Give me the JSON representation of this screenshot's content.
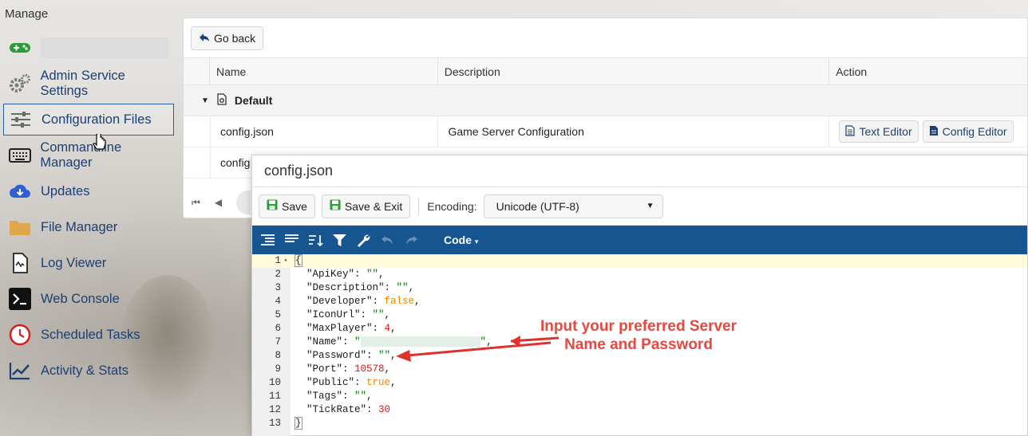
{
  "sidebar": {
    "title": "Manage",
    "items": [
      {
        "label": "",
        "icon": "gamepad-icon",
        "redacted": true
      },
      {
        "label": "Admin Service Settings",
        "icon": "gears-icon"
      },
      {
        "label": "Configuration Files",
        "icon": "sliders-icon",
        "active": true
      },
      {
        "label": "Commandline Manager",
        "icon": "keyboard-icon"
      },
      {
        "label": "Updates",
        "icon": "cloud-download-icon"
      },
      {
        "label": "File Manager",
        "icon": "folder-icon"
      },
      {
        "label": "Log Viewer",
        "icon": "log-file-icon"
      },
      {
        "label": "Web Console",
        "icon": "terminal-icon"
      },
      {
        "label": "Scheduled Tasks",
        "icon": "clock-icon"
      },
      {
        "label": "Activity & Stats",
        "icon": "chart-line-icon"
      }
    ]
  },
  "main": {
    "go_back_label": "Go back",
    "columns": {
      "name": "Name",
      "description": "Description",
      "action": "Action"
    },
    "group": {
      "label": "Default"
    },
    "rows": [
      {
        "name": "config.json",
        "description": "Game Server Configuration",
        "actions": [
          "Text Editor",
          "Config Editor"
        ]
      },
      {
        "name": "config",
        "description": "",
        "actions": []
      }
    ]
  },
  "editor": {
    "title": "config.json",
    "save_label": "Save",
    "save_exit_label": "Save & Exit",
    "encoding_label": "Encoding:",
    "encoding_value": "Unicode (UTF-8)",
    "code_menu_label": "Code",
    "lines": [
      {
        "n": "1",
        "parts": [
          [
            "p",
            "{"
          ]
        ]
      },
      {
        "n": "2",
        "parts": [
          [
            "k",
            "\"ApiKey\""
          ],
          [
            "p",
            ": "
          ],
          [
            "s",
            "\"\""
          ],
          [
            "p",
            ","
          ]
        ]
      },
      {
        "n": "3",
        "parts": [
          [
            "k",
            "\"Description\""
          ],
          [
            "p",
            ": "
          ],
          [
            "s",
            "\"\""
          ],
          [
            "p",
            ","
          ]
        ]
      },
      {
        "n": "4",
        "parts": [
          [
            "k",
            "\"Developer\""
          ],
          [
            "p",
            ": "
          ],
          [
            "b",
            "false"
          ],
          [
            "p",
            ","
          ]
        ]
      },
      {
        "n": "5",
        "parts": [
          [
            "k",
            "\"IconUrl\""
          ],
          [
            "p",
            ": "
          ],
          [
            "s",
            "\"\""
          ],
          [
            "p",
            ","
          ]
        ]
      },
      {
        "n": "6",
        "parts": [
          [
            "k",
            "\"MaxPlayer\""
          ],
          [
            "p",
            ": "
          ],
          [
            "n",
            "4"
          ],
          [
            "p",
            ","
          ]
        ]
      },
      {
        "n": "7",
        "parts": [
          [
            "k",
            "\"Name\""
          ],
          [
            "p",
            ": "
          ],
          [
            "s",
            "\""
          ],
          [
            "r",
            ""
          ],
          [
            "s",
            "\""
          ],
          [
            "p",
            ","
          ]
        ]
      },
      {
        "n": "8",
        "parts": [
          [
            "k",
            "\"Password\""
          ],
          [
            "p",
            ": "
          ],
          [
            "s",
            "\"\""
          ],
          [
            "p",
            ","
          ]
        ]
      },
      {
        "n": "9",
        "parts": [
          [
            "k",
            "\"Port\""
          ],
          [
            "p",
            ": "
          ],
          [
            "n",
            "10578"
          ],
          [
            "p",
            ","
          ]
        ]
      },
      {
        "n": "10",
        "parts": [
          [
            "k",
            "\"Public\""
          ],
          [
            "p",
            ": "
          ],
          [
            "b",
            "true"
          ],
          [
            "p",
            ","
          ]
        ]
      },
      {
        "n": "11",
        "parts": [
          [
            "k",
            "\"Tags\""
          ],
          [
            "p",
            ": "
          ],
          [
            "s",
            "\"\""
          ],
          [
            "p",
            ","
          ]
        ]
      },
      {
        "n": "12",
        "parts": [
          [
            "k",
            "\"TickRate\""
          ],
          [
            "p",
            ": "
          ],
          [
            "n",
            "30"
          ]
        ]
      },
      {
        "n": "13",
        "parts": [
          [
            "p",
            "}"
          ]
        ]
      }
    ]
  },
  "annotation": {
    "line1": "Input your preferred Server",
    "line2": "Name and Password",
    "color": "#e8483f"
  }
}
